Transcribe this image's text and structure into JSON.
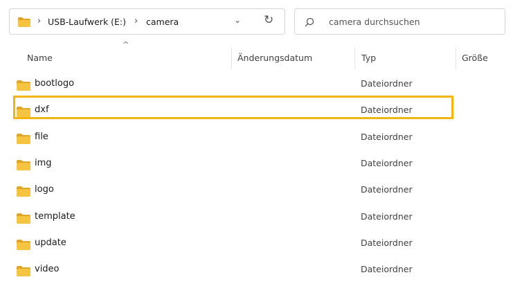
{
  "address_bar": {
    "separator": "›",
    "drive": "USB-Laufwerk (E:)",
    "folder": "camera",
    "dropdown_glyph": "⌄",
    "refresh_glyph": "↻"
  },
  "search": {
    "placeholder": "camera durchsuchen"
  },
  "columns": {
    "name": "Name",
    "date": "Änderungsdatum",
    "type": "Typ",
    "size": "Größe",
    "sort_indicator": "^"
  },
  "files": [
    {
      "name": "bootlogo",
      "type": "Dateiordner"
    },
    {
      "name": "dxf",
      "type": "Dateiordner"
    },
    {
      "name": "file",
      "type": "Dateiordner"
    },
    {
      "name": "img",
      "type": "Dateiordner"
    },
    {
      "name": "logo",
      "type": "Dateiordner"
    },
    {
      "name": "template",
      "type": "Dateiordner"
    },
    {
      "name": "update",
      "type": "Dateiordner"
    },
    {
      "name": "video",
      "type": "Dateiordner"
    }
  ],
  "colors": {
    "folder": "#f5c542",
    "folder_tab": "#e0a526",
    "highlight": "#f2b50f"
  },
  "icons": [
    "folder-icon",
    "search-icon",
    "refresh-icon",
    "chevron-down-icon",
    "chevron-right-icon"
  ]
}
